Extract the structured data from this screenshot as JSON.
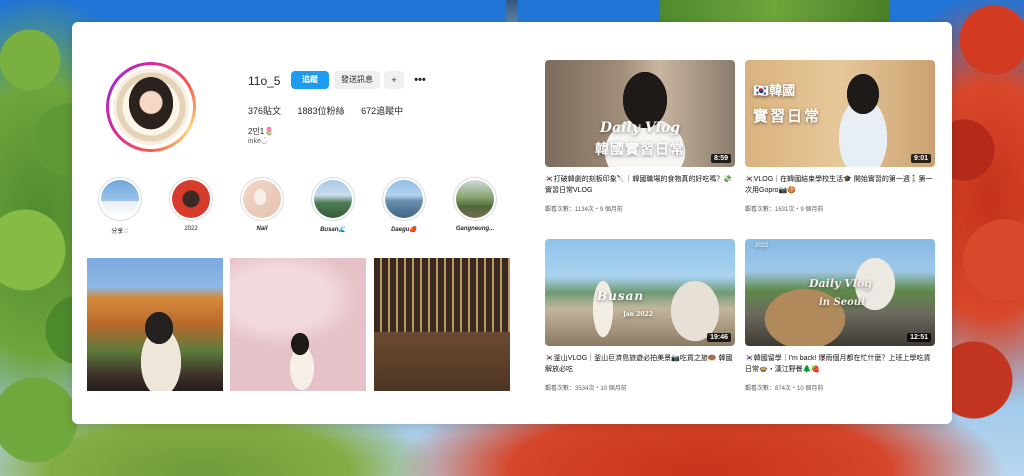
{
  "profile": {
    "username": "11o_5",
    "follow_label": "追蹤",
    "message_label": "發送訊息",
    "adduser_icon": "+",
    "more_icon": "•••",
    "stats": {
      "posts": "376貼文",
      "followers": "1883位粉絲",
      "following": "672追蹤中"
    },
    "bio_name": "2민1🌷",
    "bio_sub": "inke◡̈"
  },
  "highlights": [
    {
      "label": "分享♡"
    },
    {
      "label": "2022"
    },
    {
      "label": "Nail"
    },
    {
      "label": "Busan🌊"
    },
    {
      "label": "Daegu🍎"
    },
    {
      "label": "Gangneung..."
    }
  ],
  "videos": [
    {
      "overlay_a": "Daily Vlog",
      "overlay_b": "韓國實習日常",
      "duration": "8:59",
      "title": "🇰🇷打破韓劇的刻板印象🔪｜韓國職場的食物真的好吃嗎？💸實習日常VLOG",
      "meta": "觀看次數：1134次・9 個月前"
    },
    {
      "overlay_a": "🇰🇷韓國",
      "overlay_b": "實習日常",
      "duration": "9:01",
      "title": "🇰🇷VLOG｜在韓國結束學校生活🎓 開始實習的第一週🚶第一次用Gopro📷🍪",
      "meta": "觀看次數：1631次・9 個月前"
    },
    {
      "overlay_a": "Busan",
      "overlay_b": "Jan 2022",
      "duration": "19:46",
      "title": "🇰🇷釜山VLOG｜釜山巨濟島旅遊必拍美景📷吃貨之旅🍩 韓國解放必吃",
      "meta": "觀看次數：3534次・10 個月前"
    },
    {
      "overlay_a": "Daily Vlog",
      "overlay_b": "in Seoul",
      "overlay_c": "2022",
      "duration": "12:51",
      "title": "🇰🇷韓國留學｜I'm back! 爆雨個月都在忙什麼？上班上學吃貨日常🍲・漢江野餐🌲🍓",
      "meta": "觀看次數：874次・10 個月前"
    }
  ]
}
